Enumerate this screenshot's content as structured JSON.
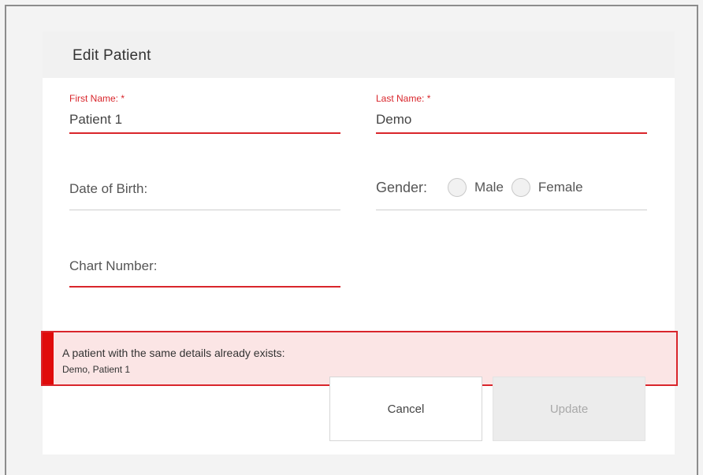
{
  "dialog": {
    "title": "Edit Patient"
  },
  "fields": {
    "first_name": {
      "label": "First Name: *",
      "value": "Patient 1"
    },
    "last_name": {
      "label": "Last Name: *",
      "value": "Demo"
    },
    "date_of_birth": {
      "label": "Date of Birth:"
    },
    "gender": {
      "label": "Gender:",
      "options": [
        "Male",
        "Female"
      ]
    },
    "chart_number": {
      "label": "Chart Number:"
    }
  },
  "alert": {
    "title": "A patient with the same details already exists:",
    "detail": "Demo, Patient 1"
  },
  "buttons": {
    "cancel": "Cancel",
    "update": "Update"
  },
  "colors": {
    "error": "#d9252b",
    "alert_bg": "#fbe5e5",
    "neutral_underline": "#cfcfcf"
  }
}
